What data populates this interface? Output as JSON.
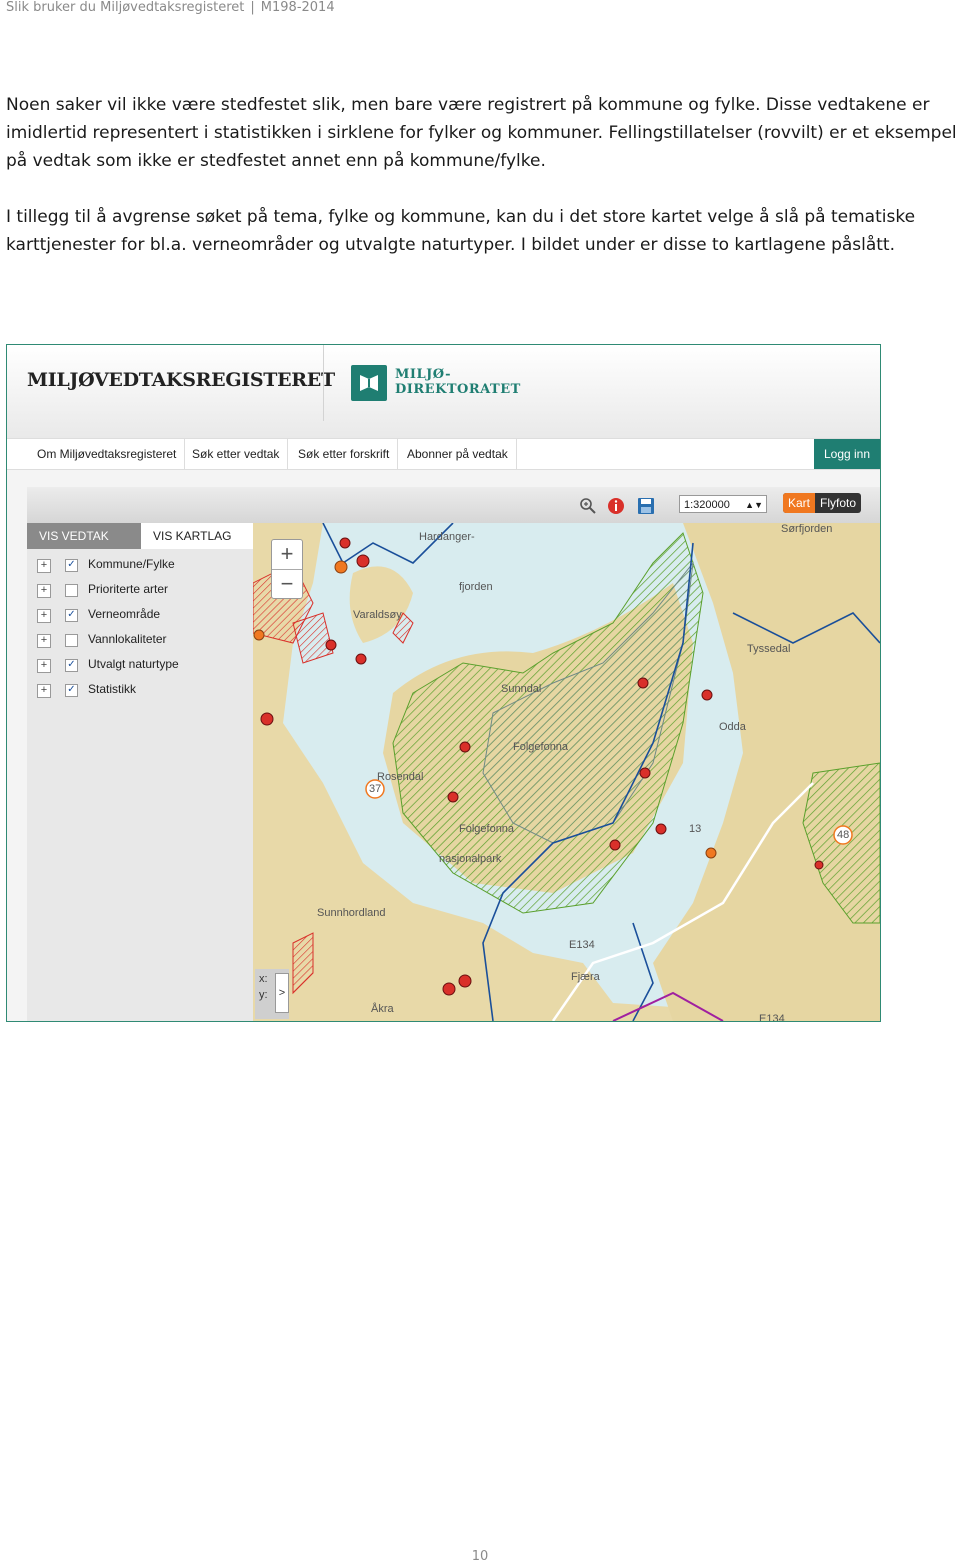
{
  "running_header": {
    "title": "Slik bruker du Miljøvedtaksregisteret",
    "code": "M198-2014"
  },
  "paragraphs": [
    "Noen saker vil ikke være stedfestet slik, men bare være registrert på kommune og fylke. Disse vedtakene er imidlertid representert i statistikken i sirklene for fylker og kommuner. Fellingstillatelser (rovvilt) er et eksempel på vedtak som ikke er stedfestet annet enn på kommune/fylke.",
    "I tillegg til å avgrense søket på tema, fylke og kommune, kan du i det store kartet velge å slå på tematiske karttjenester for bl.a. verneområder og utvalgte naturtyper. I bildet under er disse to kartlagene påslått."
  ],
  "screenshot": {
    "app_title": "MILJØVEDTAKSREGISTERET",
    "logo": {
      "line1": "MILJØ-",
      "line2": "DIREKTORATET",
      "color": "#1f7e72"
    },
    "nav": {
      "items": [
        "Om Miljøvedtaksregisteret",
        "Søk etter vedtak",
        "Søk etter forskrift",
        "Abonner på vedtak"
      ],
      "login": "Logg inn"
    },
    "toolbar": {
      "icons": [
        "zoom-in-magnifier-icon",
        "info-icon",
        "save-icon"
      ],
      "scale": "1:320000",
      "basemap": [
        "Kart",
        "Flyfoto"
      ],
      "basemap_active": "Kart"
    },
    "panel": {
      "tabs": [
        "VIS VEDTAK",
        "VIS KARTLAG"
      ],
      "active_tab": "VIS VEDTAK",
      "layers": [
        {
          "label": "Kommune/Fylke",
          "checked": true
        },
        {
          "label": "Prioriterte arter",
          "checked": false
        },
        {
          "label": "Verneområde",
          "checked": true
        },
        {
          "label": "Vannlokaliteter",
          "checked": false
        },
        {
          "label": "Utvalgt naturtype",
          "checked": true
        },
        {
          "label": "Statistikk",
          "checked": true
        }
      ]
    },
    "map": {
      "zoom_in": "+",
      "zoom_out": "−",
      "coord_x": "x:",
      "coord_y": "y:",
      "coord_toggle": ">",
      "labels": [
        "Hardanger-",
        "fjorden",
        "Varaldsøy",
        "Sunndal",
        "Tyssedal",
        "Odda",
        "Folgefonna",
        "Rosendal",
        "Folgefonna",
        "nasjonalpark",
        "Sunnhordland",
        "Fjæra",
        "Åkra",
        "Sørfjorden",
        "E134",
        "E134",
        "37",
        "13",
        "48"
      ],
      "colors": {
        "water": "#d8ecef",
        "land": "#e8d9a8",
        "protected": "#8cc63f",
        "naturtype": "#d9302a",
        "border": "#1a4f9a"
      }
    }
  },
  "page_number": "10"
}
